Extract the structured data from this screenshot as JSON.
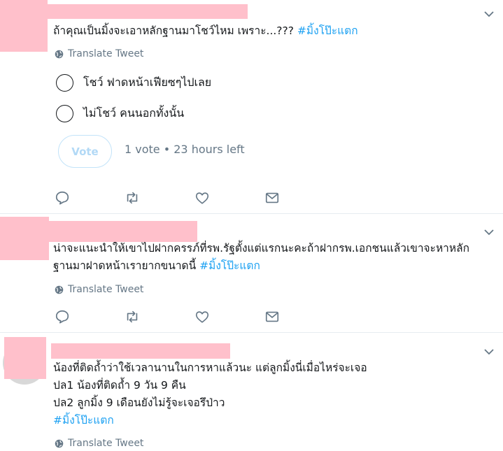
{
  "tweets": [
    {
      "text_lines": [
        {
          "text": "ถ้าคุณเป็นมิ้งจะเอาหลักฐานมาโชว์ไหม เพราะ...??? ",
          "hashtag": "#มิ้งโป๊ะแตก"
        }
      ],
      "translate_label": "Translate Tweet",
      "poll": {
        "options": [
          "โชว์ ฟาดหน้าเฟียซๆไปเลย",
          "ไม่โชว์ คนนอกทั้งนั้น"
        ],
        "vote_label": "Vote",
        "meta": "1 vote • 23 hours left"
      }
    },
    {
      "text_lines": [
        {
          "text": "น่าจะแนะนำให้เขาไปฝากครรภ์ที่รพ.รัฐตั้งแต่แรกนะคะถ้าฝากรพ.เอกชนแล้วเขาจะหาหลัก",
          "hashtag": ""
        },
        {
          "text": "ฐานมาฝาดหน้าเรายากขนาดนี้ ",
          "hashtag": "#มิ้งโป๊ะแตก"
        }
      ],
      "translate_label": "Translate Tweet"
    },
    {
      "text_lines": [
        {
          "text": "น้องที่ติดถ้ำว่าใช้เวลานานในการหาแล้วนะ แต่ลูกมิ้งนี่เมื่อไหร่จะเจอ",
          "hashtag": ""
        },
        {
          "text": "ปล1 น้องที่ติดถ้ำ 9 วัน 9 คืน",
          "hashtag": ""
        },
        {
          "text": "ปล2 ลูกมิ้ง 9 เดือนยังไม่รู้จะเจอรึป่าว",
          "hashtag": ""
        },
        {
          "text": "",
          "hashtag": "#มิ้งโป๊ะแตก"
        }
      ],
      "translate_label": "Translate Tweet"
    }
  ],
  "icons": [
    "chevron-down-icon",
    "globe-icon",
    "reply-icon",
    "retweet-icon",
    "like-icon",
    "direct-message-icon"
  ],
  "colors": {
    "hashtag": "#1da1f2",
    "muted": "#657786",
    "redaction": "#ffc0cb",
    "divider": "#e6ecf0"
  }
}
